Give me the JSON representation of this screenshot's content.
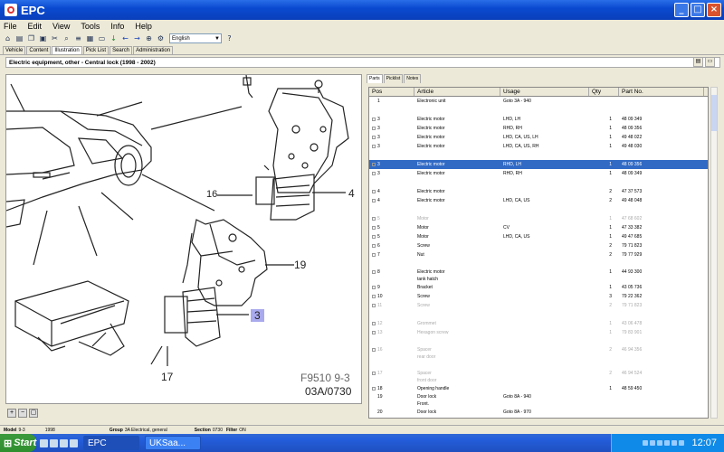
{
  "window": {
    "title": "EPC"
  },
  "menu": [
    "File",
    "Edit",
    "View",
    "Tools",
    "Info",
    "Help"
  ],
  "toolbar": {
    "language": "English"
  },
  "tabs": [
    "Vehicle",
    "Content",
    "Illustration",
    "Pick List",
    "Search",
    "Administration"
  ],
  "header": {
    "title": "Electric equipment, other - Central lock   (1998 - 2002)"
  },
  "illustration": {
    "callouts": [
      "16",
      "4",
      "19",
      "3",
      "17"
    ],
    "ref1": "F9510 9-3",
    "ref2": "03A/0730"
  },
  "parts_tabs": [
    "Parts",
    "Picklist",
    "Notes"
  ],
  "grid": {
    "headers": [
      "Pos",
      "Article",
      "Usage",
      "Qty",
      "Part No."
    ],
    "rows": [
      {
        "pos": "1",
        "article": "Electronic unit",
        "usage": "Goto 3A - 940",
        "qty": "",
        "part": "",
        "cb": false
      },
      {
        "pos": "",
        "article": "",
        "usage": "",
        "qty": "",
        "part": "",
        "cb": false
      },
      {
        "pos": "3",
        "article": "Electric motor",
        "usage": "LHD, LH",
        "qty": "1",
        "part": "48 09 349",
        "cb": true
      },
      {
        "pos": "3",
        "article": "Electric motor",
        "usage": "RHD, RH",
        "qty": "1",
        "part": "48 09 356",
        "cb": true
      },
      {
        "pos": "3",
        "article": "Electric motor",
        "usage": "LHD, CA, US, LH",
        "qty": "1",
        "part": "49 48 022",
        "cb": true
      },
      {
        "pos": "3",
        "article": "Electric motor",
        "usage": "LHD, CA, US, RH",
        "qty": "1",
        "part": "49 48 030",
        "cb": true
      },
      {
        "pos": "",
        "article": "",
        "usage": "",
        "qty": "",
        "part": "",
        "cb": false
      },
      {
        "pos": "3",
        "article": "Electric motor",
        "usage": "RHD, LH",
        "qty": "1",
        "part": "48 09 356",
        "cb": true,
        "sel": true
      },
      {
        "pos": "3",
        "article": "Electric motor",
        "usage": "RHD, RH",
        "qty": "1",
        "part": "48 09 349",
        "cb": true
      },
      {
        "pos": "",
        "article": "",
        "usage": "",
        "qty": "",
        "part": "",
        "cb": false
      },
      {
        "pos": "4",
        "article": "Electric motor",
        "usage": "",
        "qty": "2",
        "part": "47 37 573",
        "cb": true
      },
      {
        "pos": "4",
        "article": "Electric motor",
        "usage": "LHD, CA, US",
        "qty": "2",
        "part": "49 48 048",
        "cb": true
      },
      {
        "pos": "",
        "article": "",
        "usage": "",
        "qty": "",
        "part": "",
        "cb": false
      },
      {
        "pos": "5",
        "article": "Motor",
        "usage": "",
        "qty": "1",
        "part": "47 68 602",
        "cb": true,
        "grey": true
      },
      {
        "pos": "5",
        "article": "Motor",
        "usage": "CV",
        "qty": "1",
        "part": "47 33 382",
        "cb": true
      },
      {
        "pos": "5",
        "article": "Motor",
        "usage": "LHD, CA, US",
        "qty": "1",
        "part": "49 47 685",
        "cb": true
      },
      {
        "pos": "6",
        "article": "Screw",
        "usage": "",
        "qty": "2",
        "part": "79 71 823",
        "cb": true
      },
      {
        "pos": "7",
        "article": "Nut",
        "usage": "",
        "qty": "2",
        "part": "79 77 929",
        "cb": true
      },
      {
        "pos": "",
        "article": "",
        "usage": "",
        "qty": "",
        "part": "",
        "cb": false
      },
      {
        "pos": "8",
        "article": "Electric motor",
        "usage": "",
        "qty": "1",
        "part": "44 93 300",
        "cb": true,
        "sub": "tank hatch"
      },
      {
        "pos": "9",
        "article": "Bracket",
        "usage": "",
        "qty": "1",
        "part": "43 05 736",
        "cb": true
      },
      {
        "pos": "10",
        "article": "Screw",
        "usage": "",
        "qty": "3",
        "part": "79 22 362",
        "cb": true
      },
      {
        "pos": "11",
        "article": "Screw",
        "usage": "",
        "qty": "2",
        "part": "79 71 823",
        "cb": true,
        "grey": true
      },
      {
        "pos": "",
        "article": "",
        "usage": "",
        "qty": "",
        "part": "",
        "cb": false
      },
      {
        "pos": "12",
        "article": "Grommet",
        "usage": "",
        "qty": "1",
        "part": "43 06 478",
        "cb": true,
        "grey": true
      },
      {
        "pos": "13",
        "article": "Hexagon screw",
        "usage": "",
        "qty": "1",
        "part": "79 83 901",
        "cb": true,
        "grey": true
      },
      {
        "pos": "",
        "article": "",
        "usage": "",
        "qty": "",
        "part": "",
        "cb": false
      },
      {
        "pos": "16",
        "article": "Spacer",
        "usage": "",
        "qty": "2",
        "part": "46 94 356",
        "cb": true,
        "grey": true,
        "sub": "rear door"
      },
      {
        "pos": "",
        "article": "",
        "usage": "",
        "qty": "",
        "part": "",
        "cb": false
      },
      {
        "pos": "17",
        "article": "Spacer",
        "usage": "",
        "qty": "2",
        "part": "46 94 524",
        "cb": true,
        "grey": true,
        "sub": "front door"
      },
      {
        "pos": "18",
        "article": "Opening handle",
        "usage": "",
        "qty": "1",
        "part": "48 59 450",
        "cb": true
      },
      {
        "pos": "19",
        "article": "Door lock",
        "usage": "Goto 8A - 940",
        "qty": "",
        "part": "",
        "cb": false,
        "sub": "Front."
      },
      {
        "pos": "20",
        "article": "Door lock",
        "usage": "Goto 8A - 970",
        "qty": "",
        "part": "",
        "cb": false
      }
    ]
  },
  "status": {
    "model_label": "Model",
    "model": "9-3",
    "year": "1998",
    "group_label": "Group",
    "group": "3A Electrical, general",
    "section_label": "Section",
    "section": "0730",
    "filter_label": "Filter",
    "filter": "ON"
  },
  "taskbar": {
    "start": "Start",
    "task1": "EPC",
    "task2": "UKSaa...",
    "time": "12:07"
  },
  "colors": {
    "selection": "#316ac5",
    "callout_highlight": "#a9a9ee",
    "titlebar": "#0a4ad0"
  }
}
